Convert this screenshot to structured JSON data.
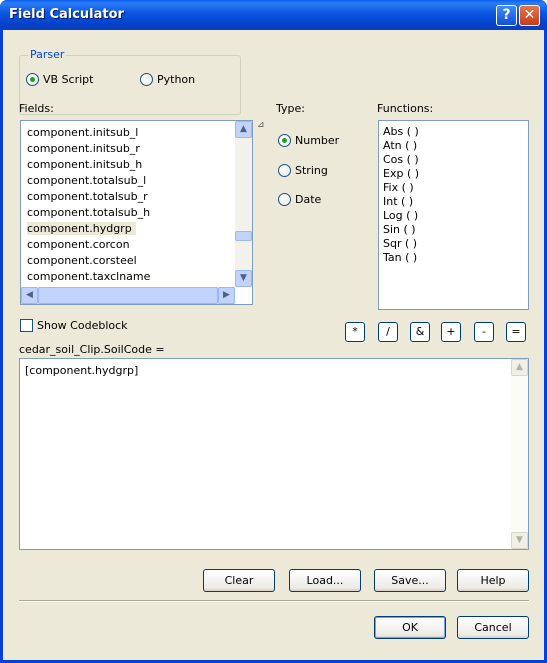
{
  "window": {
    "title": "Field Calculator",
    "help_glyph": "?",
    "close_glyph": "✕"
  },
  "parser": {
    "legend": "Parser",
    "options": [
      {
        "label": "VB Script",
        "selected": true
      },
      {
        "label": "Python",
        "selected": false
      }
    ]
  },
  "fields": {
    "label": "Fields:",
    "items": [
      "component.initsub_l",
      "component.initsub_r",
      "component.initsub_h",
      "component.totalsub_l",
      "component.totalsub_r",
      "component.totalsub_h",
      "component.hydgrp",
      "component.corcon",
      "component.corsteel",
      "component.taxclname"
    ],
    "selected_item": "component.hydgrp"
  },
  "type": {
    "label": "Type:",
    "options": [
      {
        "label": "Number",
        "selected": true
      },
      {
        "label": "String",
        "selected": false
      },
      {
        "label": "Date",
        "selected": false
      }
    ]
  },
  "functions": {
    "label": "Functions:",
    "items": [
      "Abs ( )",
      "Atn ( )",
      "Cos ( )",
      "Exp ( )",
      "Fix ( )",
      "Int ( )",
      "Log ( )",
      "Sin ( )",
      "Sqr ( )",
      "Tan ( )"
    ]
  },
  "operators": [
    "*",
    "/",
    "&",
    "+",
    "-",
    "="
  ],
  "show_codeblock": {
    "label": "Show Codeblock",
    "checked": false
  },
  "expression": {
    "target_label": "cedar_soil_Clip.SoilCode =",
    "value": "[component.hydgrp]"
  },
  "buttons": {
    "clear": "Clear",
    "load": "Load...",
    "save": "Save...",
    "help": "Help",
    "ok": "OK",
    "cancel": "Cancel"
  },
  "colors": {
    "title_bar": "#0a55e0",
    "dialog_bg": "#ece9d8",
    "accent": "#0046d5"
  }
}
